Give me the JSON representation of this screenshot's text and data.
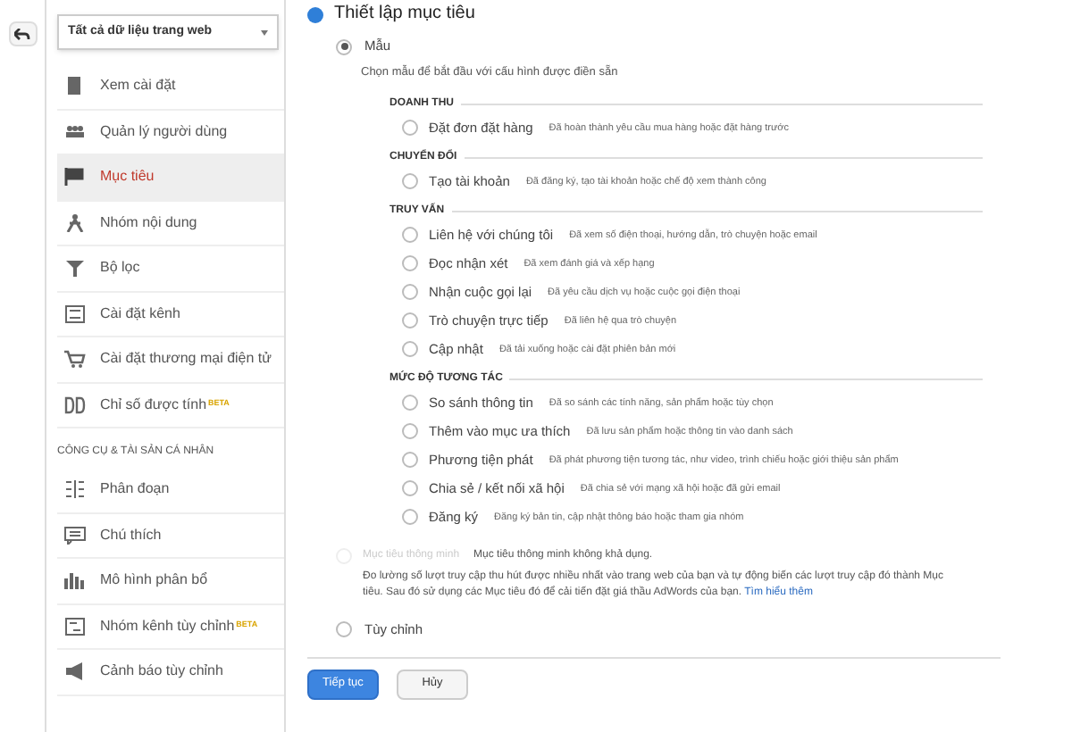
{
  "view_selector": {
    "value": "Tất cả dữ liệu trang web"
  },
  "sidebar": {
    "items": [
      {
        "label": "Xem cài đặt",
        "selected": false
      },
      {
        "label": "Quản lý người dùng",
        "selected": false
      },
      {
        "label": "Mục tiêu",
        "selected": true
      },
      {
        "label": "Nhóm nội dung",
        "selected": false
      },
      {
        "label": "Bộ lọc",
        "selected": false
      },
      {
        "label": "Cài đặt kênh",
        "selected": false
      },
      {
        "label": "Cài đặt thương mại điện tử",
        "selected": false
      },
      {
        "label": "Chỉ số được tính",
        "badge": "BETA",
        "selected": false
      }
    ],
    "section_title": "CÔNG CỤ & TÀI SẢN CÁ NHÂN",
    "section_items": [
      {
        "label": "Phân đoạn",
        "selected": false
      },
      {
        "label": "Chú thích",
        "selected": false
      },
      {
        "label": "Mô hình phân bổ",
        "selected": false
      },
      {
        "label": "Nhóm kênh tùy chỉnh",
        "badge": "BETA",
        "selected": false
      },
      {
        "label": "Cảnh báo tùy chỉnh",
        "selected": false
      }
    ]
  },
  "step": {
    "title": "Thiết lập mục tiêu"
  },
  "template": {
    "label": "Mẫu",
    "selected": true,
    "hint": "Chọn mẫu để bắt đầu với cấu hình được điền sẵn",
    "groups": [
      {
        "title": "DOANH THU",
        "options": [
          {
            "label": "Đặt đơn đặt hàng",
            "description": "Đã hoàn thành yêu cầu mua hàng hoặc đặt hàng trước",
            "selected": false
          }
        ]
      },
      {
        "title": "CHUYỂN ĐỔI",
        "options": [
          {
            "label": "Tạo tài khoản",
            "description": "Đã đăng ký, tạo tài khoản hoặc chế độ xem thành công",
            "selected": false
          }
        ]
      },
      {
        "title": "TRUY VẤN",
        "options": [
          {
            "label": "Liên hệ với chúng tôi",
            "description": "Đã xem số điện thoại, hướng dẫn, trò chuyện hoặc email",
            "selected": false
          },
          {
            "label": "Đọc nhận xét",
            "description": "Đã xem đánh giá và xếp hạng",
            "selected": false
          },
          {
            "label": "Nhận cuộc gọi lại",
            "description": "Đã yêu cầu dịch vụ hoặc cuộc gọi điện thoại",
            "selected": false
          },
          {
            "label": "Trò chuyện trực tiếp",
            "description": "Đã liên hệ qua trò chuyện",
            "selected": false
          },
          {
            "label": "Cập nhật",
            "description": "Đã tải xuống hoặc cài đặt phiên bản mới",
            "selected": false
          }
        ]
      },
      {
        "title": "MỨC ĐỘ TƯƠNG TÁC",
        "options": [
          {
            "label": "So sánh thông tin",
            "description": "Đã so sánh các tính năng, sản phẩm hoặc tùy chọn",
            "selected": false
          },
          {
            "label": "Thêm vào mục ưa thích",
            "description": "Đã lưu sản phẩm hoặc thông tin vào danh sách",
            "selected": false
          },
          {
            "label": "Phương tiện phát",
            "description": "Đã phát phương tiện tương tác, như video, trình chiếu hoặc giới thiệu sản phẩm",
            "selected": false
          },
          {
            "label": "Chia sẻ / kết nối xã hội",
            "description": "Đã chia sẻ với mạng xã hội hoặc đã gửi email",
            "selected": false
          },
          {
            "label": "Đăng ký",
            "description": "Đăng ký bản tin, cập nhật thông báo hoặc tham gia nhóm",
            "selected": false
          }
        ]
      }
    ]
  },
  "smart_goals": {
    "label": "Mục tiêu thông minh",
    "disabled": true,
    "selected": false,
    "status": "Mục tiêu thông minh không khả dụng.",
    "description": "Đo lường số lượt truy cập thu hút được nhiều nhất vào trang web của bạn và tự động biến các lượt truy cập đó thành Mục tiêu. Sau đó sử dụng các Mục tiêu đó để cải tiến đặt giá thầu AdWords của bạn.",
    "link": "Tìm hiểu thêm"
  },
  "custom": {
    "label": "Tùy chỉnh",
    "selected": false
  },
  "buttons": [
    {
      "label": "Tiếp tục",
      "kind": "primary"
    },
    {
      "label": "Hủy",
      "kind": "secondary"
    }
  ]
}
